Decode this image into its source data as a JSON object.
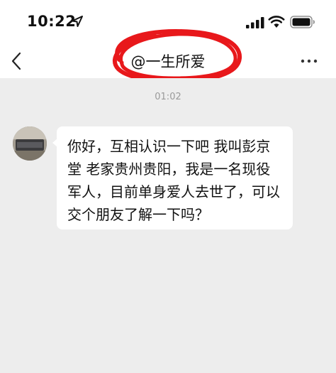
{
  "status_bar": {
    "time": "10:22",
    "icons": [
      "location-arrow-icon",
      "cellular-signal-icon",
      "wifi-icon",
      "battery-icon"
    ]
  },
  "nav": {
    "title": "@一生所爱",
    "back_icon": "chevron-left-icon",
    "more_icon": "more-dots-icon",
    "annotation_color": "#e8181b"
  },
  "chat": {
    "timestamp": "01:02",
    "messages": [
      {
        "sender": "incoming",
        "text": "你好，互相认识一下吧 我叫彭京堂  老家贵州贵阳，我是一名现役军人，目前单身爱人去世了，可以交个朋友了解一下吗？"
      }
    ]
  },
  "colors": {
    "background": "#ededed",
    "bubble": "#ffffff",
    "timestamp": "#9a9a9a"
  }
}
